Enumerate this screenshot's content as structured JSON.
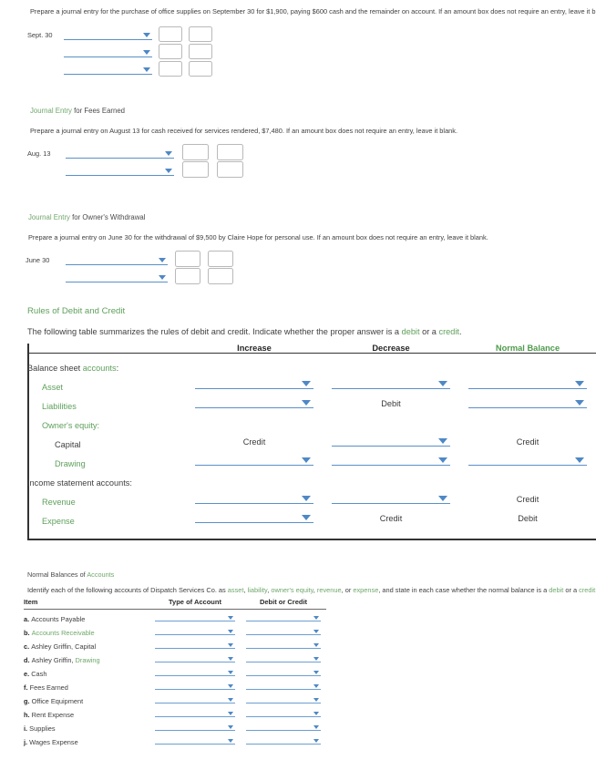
{
  "sections": {
    "supplies": {
      "prompt": "Prepare a journal entry for the purchase of office supplies on September 30 for $1,900, paying $600 cash and the remainder on account. If an amount box does not require an entry, leave it blank.",
      "date": "Sept. 30",
      "rows": 3
    },
    "fees": {
      "heading_green": "Journal Entry",
      "heading_rest": " for Fees Earned",
      "prompt": "Prepare a journal entry on August 13 for cash received for services rendered, $7,480. If an amount box does not require an entry, leave it blank.",
      "date": "Aug. 13",
      "rows": 2
    },
    "withdrawal": {
      "heading_green": "Journal Entry",
      "heading_rest": " for Owner's Withdrawal",
      "prompt": "Prepare a journal entry on June 30 for the withdrawal of $9,500 by Claire Hope for personal use. If an amount box does not require an entry, leave it blank.",
      "date": "June 30",
      "rows": 2
    },
    "rules": {
      "heading": "Rules of Debit and Credit",
      "prompt_1": "The following table summarizes the rules of debit and credit. Indicate whether the proper answer is a ",
      "prompt_debit": "debit",
      "prompt_2": " or a ",
      "prompt_credit": "credit",
      "prompt_3": ".",
      "columns": [
        "",
        "Increase",
        "Decrease",
        "Normal Balance"
      ],
      "rows": [
        {
          "label_plain": "Balance sheet ",
          "label_green": "accounts",
          "label_tail": ":",
          "indent": 0,
          "cells": [
            null,
            null,
            null
          ]
        },
        {
          "label_green_full": "Asset",
          "indent": 1,
          "cells": [
            {
              "type": "select"
            },
            {
              "type": "select"
            },
            {
              "type": "select"
            }
          ]
        },
        {
          "label_green_full": "Liabilities",
          "indent": 1,
          "cells": [
            {
              "type": "select"
            },
            {
              "type": "text",
              "value": "Debit"
            },
            {
              "type": "select"
            }
          ]
        },
        {
          "label_green_full": "Owner's equity:",
          "indent": 1,
          "cells": [
            null,
            null,
            null
          ]
        },
        {
          "label_plain_full": "Capital",
          "indent": 2,
          "cells": [
            {
              "type": "text",
              "value": "Credit"
            },
            {
              "type": "select"
            },
            {
              "type": "text",
              "value": "Credit"
            }
          ]
        },
        {
          "label_green_full": "Drawing",
          "indent": 2,
          "cells": [
            {
              "type": "select"
            },
            {
              "type": "select"
            },
            {
              "type": "select"
            }
          ]
        },
        {
          "label_plain_full": "Income statement accounts:",
          "indent": 0,
          "cells": [
            null,
            null,
            null
          ]
        },
        {
          "label_green_full": "Revenue",
          "indent": 1,
          "cells": [
            {
              "type": "select"
            },
            {
              "type": "select"
            },
            {
              "type": "text",
              "value": "Credit"
            }
          ]
        },
        {
          "label_green_full": "Expense",
          "indent": 1,
          "cells": [
            {
              "type": "select"
            },
            {
              "type": "text",
              "value": "Credit"
            },
            {
              "type": "text",
              "value": "Debit"
            }
          ]
        }
      ]
    },
    "normal_balances": {
      "heading_plain": "Normal Balances of ",
      "heading_green": "Accounts",
      "prompt_segments": [
        {
          "t": "Identify each of the following accounts of Dispatch Services Co. as ",
          "g": false
        },
        {
          "t": "asset",
          "g": true
        },
        {
          "t": ", ",
          "g": false
        },
        {
          "t": "liability",
          "g": true
        },
        {
          "t": ", ",
          "g": false
        },
        {
          "t": "owner's equity",
          "g": true
        },
        {
          "t": ", ",
          "g": false
        },
        {
          "t": "revenue",
          "g": true
        },
        {
          "t": ", or ",
          "g": false
        },
        {
          "t": "expense",
          "g": true
        },
        {
          "t": ", and state in each case whether the normal balance is a ",
          "g": false
        },
        {
          "t": "debit",
          "g": true
        },
        {
          "t": " or a ",
          "g": false
        },
        {
          "t": "credit",
          "g": true
        },
        {
          "t": ":",
          "g": false
        }
      ],
      "columns": [
        "Item",
        "Type of Account",
        "Debit or Credit"
      ],
      "items": [
        {
          "letter": "a.",
          "name_plain": "Accounts Payable",
          "name_green": ""
        },
        {
          "letter": "b.",
          "name_plain": "",
          "name_green": "Accounts Receivable"
        },
        {
          "letter": "c.",
          "name_plain": "Ashley Griffin, Capital",
          "name_green": ""
        },
        {
          "letter": "d.",
          "name_plain": "Ashley Griffin, ",
          "name_green": "Drawing"
        },
        {
          "letter": "e.",
          "name_plain": "Cash",
          "name_green": ""
        },
        {
          "letter": "f.",
          "name_plain": "Fees Earned",
          "name_green": ""
        },
        {
          "letter": "g.",
          "name_plain": "Office Equipment",
          "name_green": ""
        },
        {
          "letter": "h.",
          "name_plain": "Rent Expense",
          "name_green": ""
        },
        {
          "letter": "i.",
          "name_plain": "Supplies",
          "name_green": ""
        },
        {
          "letter": "j.",
          "name_plain": "Wages Expense",
          "name_green": ""
        }
      ]
    }
  },
  "colors": {
    "green": "#6fa86b",
    "green_head": "#5fa05c",
    "blue_underline": "#5a90c8",
    "blue_caret": "#4e88c6",
    "text": "#3f3f3f",
    "rule": "#333333"
  }
}
